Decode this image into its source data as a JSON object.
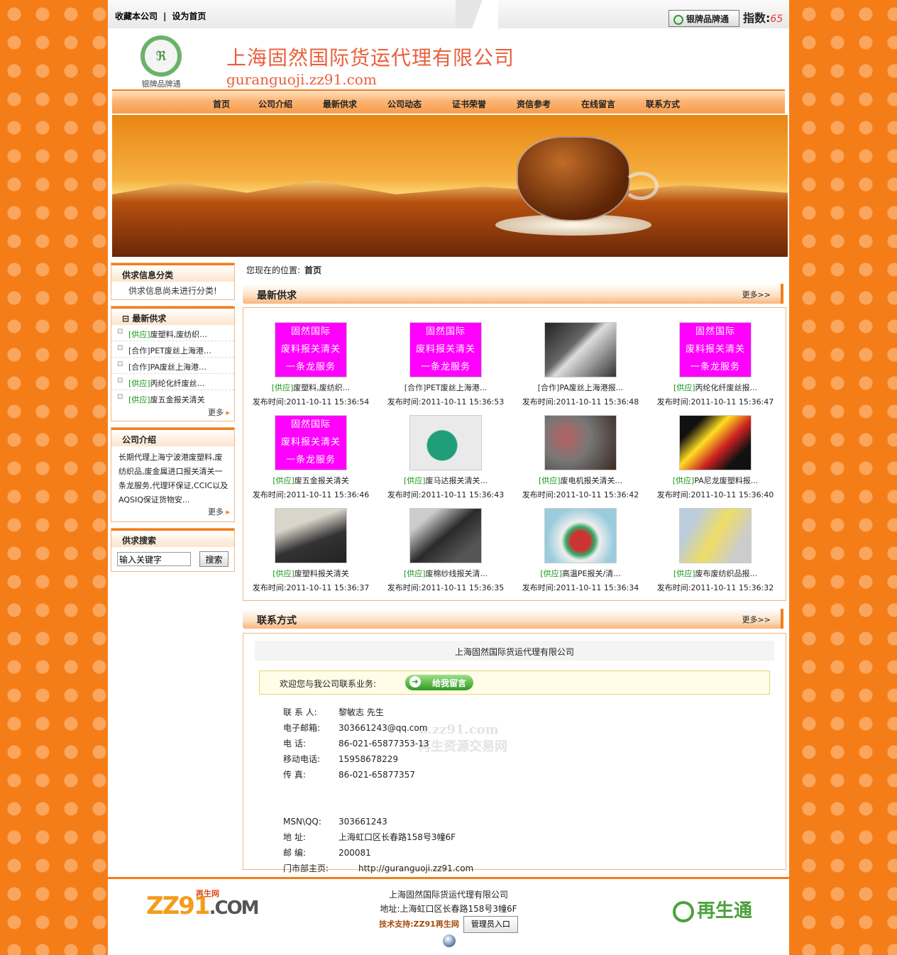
{
  "topbar": {
    "favorite": "收藏本公司",
    "sep": "|",
    "homepage": "设为首页",
    "badge": "银牌品牌通",
    "index_label": "指数:",
    "index_value": "65"
  },
  "header": {
    "logo_caption": "银牌品牌通",
    "logo_mark": "ℜ",
    "company": "上海固然国际货运代理有限公司",
    "url": "guranguoji.zz91.com"
  },
  "nav": [
    "首页",
    "公司介绍",
    "最新供求",
    "公司动态",
    "证书荣誉",
    "资信参考",
    "在线留言",
    "联系方式"
  ],
  "side": {
    "cat_title": "供求信息分类",
    "cat_empty": "供求信息尚未进行分类!",
    "latest_title": "最新供求",
    "latest": [
      {
        "tag": "[供应]",
        "text": "废塑料,废纺织…"
      },
      {
        "tag": "[合作]",
        "text": "PET废丝上海港…"
      },
      {
        "tag": "[合作]",
        "text": "PA废丝上海港…"
      },
      {
        "tag": "[供应]",
        "text": "丙纶化纤废丝…"
      },
      {
        "tag": "[供应]",
        "text": "废五金报关清关"
      }
    ],
    "more": "更多",
    "intro_title": "公司介绍",
    "intro_text": "长期代理上海宁波港废塑料,废纺织品,废金属进口报关清关一条龙服务,代理环保证,CCIC以及AQSIQ保证货物安...",
    "search_title": "供求搜索",
    "search_placeholder": "输入关键字",
    "search_btn": "搜索"
  },
  "crumb": {
    "label": "您现在的位置:",
    "current": "首页"
  },
  "latest_section": {
    "title": "最新供求",
    "more": "更多>>"
  },
  "pink_text": [
    "固然国际",
    "废料报关清关",
    "一条龙服务"
  ],
  "products": [
    {
      "tag": "[供应]",
      "name": "废塑料,废纺织...",
      "time_label": "发布时间:",
      "time": "2011-10-11 15:36:54",
      "img": "pink"
    },
    {
      "tag": "[合作]",
      "name": "PET废丝上海港...",
      "time_label": "发布时间:",
      "time": "2011-10-11 15:36:53",
      "img": "pink"
    },
    {
      "tag": "[合作]",
      "name": "PA废丝上海港报...",
      "time_label": "发布时间:",
      "time": "2011-10-11 15:36:48",
      "img": "dark"
    },
    {
      "tag": "[供应]",
      "name": "丙纶化纤废丝报...",
      "time_label": "发布时间:",
      "time": "2011-10-11 15:36:47",
      "img": "pink"
    },
    {
      "tag": "[供应]",
      "name": "废五金报关清关",
      "time_label": "发布时间:",
      "time": "2011-10-11 15:36:46",
      "img": "pink"
    },
    {
      "tag": "[供应]",
      "name": "废马达报关清关...",
      "time_label": "发布时间:",
      "time": "2011-10-11 15:36:43",
      "img": "motor"
    },
    {
      "tag": "[供应]",
      "name": "废电机报关清关...",
      "time_label": "发布时间:",
      "time": "2011-10-11 15:36:42",
      "img": "brown"
    },
    {
      "tag": "[供应]",
      "name": "PA尼龙废塑料报...",
      "time_label": "发布时间:",
      "time": "2011-10-11 15:36:40",
      "img": "yellow"
    },
    {
      "tag": "[供应]",
      "name": "废塑料报关清关",
      "time_label": "发布时间:",
      "time": "2011-10-11 15:36:37",
      "img": "grey"
    },
    {
      "tag": "[供应]",
      "name": "废棉纱线报关清...",
      "time_label": "发布时间:",
      "time": "2011-10-11 15:36:35",
      "img": "cloth"
    },
    {
      "tag": "[供应]",
      "name": "高温PE报关/清...",
      "time_label": "发布时间:",
      "time": "2011-10-11 15:36:34",
      "img": "tape"
    },
    {
      "tag": "[供应]",
      "name": "废布废纺织品报...",
      "time_label": "发布时间:",
      "time": "2011-10-11 15:36:32",
      "img": "room"
    }
  ],
  "contact_section": {
    "title": "联系方式",
    "more": "更多>>"
  },
  "contact": {
    "company": "上海固然国际货运代理有限公司",
    "welcome": "欢迎您与我公司联系业务:",
    "msg_btn": "给我留言",
    "rows": [
      {
        "label": "联 系 人:",
        "value": "黎敏志 先生"
      },
      {
        "label": "电子邮箱:",
        "value": "303661243@qq.com"
      },
      {
        "label": "电    话:",
        "value": "86-021-65877353-13"
      },
      {
        "label": "移动电话:",
        "value": "15958678229"
      },
      {
        "label": "传    真:",
        "value": "86-021-65877357"
      },
      {
        "label": "",
        "value": ""
      },
      {
        "label": "",
        "value": ""
      },
      {
        "label": "MSN\\QQ:",
        "value": "303661243"
      },
      {
        "label": "地    址:",
        "value": "上海虹口区长春路158号3幢6F"
      },
      {
        "label": "邮    编:",
        "value": "200081"
      },
      {
        "label": "门市部主页:",
        "value": "http://guranguoji.zz91.com"
      }
    ],
    "watermark1": "w.zz91.com",
    "watermark2": "再生资源交易网"
  },
  "footer": {
    "logo": "ZZ91",
    "logo2": ".COM",
    "logo_tag": "再生网",
    "company": "上海固然国际货运代理有限公司",
    "address": "地址:上海虹口区长春路158号3幢6F",
    "tech": "技术支持:ZZ91再生网",
    "admin": "管理员入口",
    "right_logo": "再生通"
  }
}
